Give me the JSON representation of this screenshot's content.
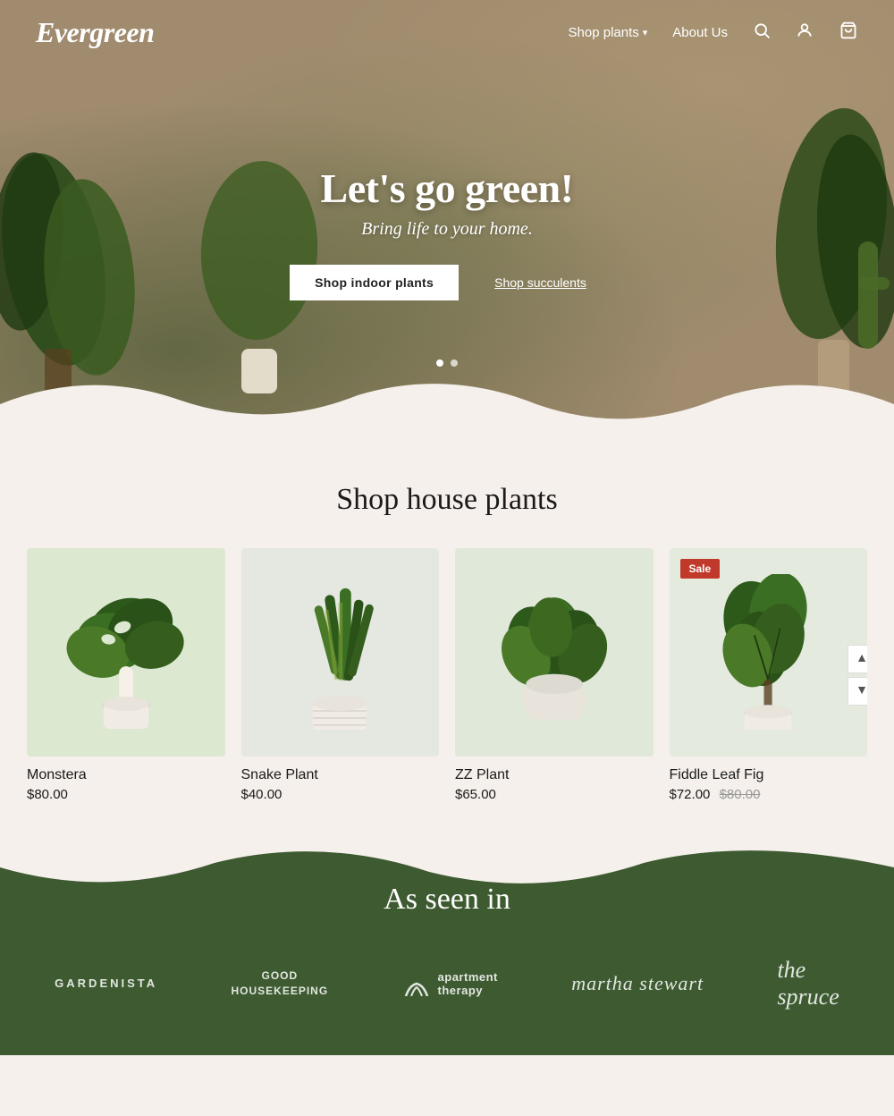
{
  "nav": {
    "logo": "Evergreen",
    "links": [
      {
        "id": "shop-plants",
        "label": "Shop plants",
        "hasDropdown": true
      },
      {
        "id": "about-us",
        "label": "About Us"
      }
    ],
    "icons": {
      "search": "🔍",
      "account": "👤",
      "cart": "🛒"
    }
  },
  "hero": {
    "title": "Let's go green!",
    "subtitle": "Bring life to your home.",
    "button_primary": "Shop indoor plants",
    "button_secondary": "Shop succulents",
    "dots": [
      {
        "active": true
      },
      {
        "active": false
      }
    ]
  },
  "shop": {
    "section_title": "Shop house plants",
    "products": [
      {
        "id": "monstera",
        "name": "Monstera",
        "price": "$80.00",
        "original_price": null,
        "sale": false,
        "color": "#d4e8c2"
      },
      {
        "id": "snake-plant",
        "name": "Snake Plant",
        "price": "$40.00",
        "original_price": null,
        "sale": false,
        "color": "#e0ead4"
      },
      {
        "id": "zz-plant",
        "name": "ZZ Plant",
        "price": "$65.00",
        "original_price": null,
        "sale": false,
        "color": "#dce8d8"
      },
      {
        "id": "fiddle-leaf-fig",
        "name": "Fiddle Leaf Fig",
        "price": "$72.00",
        "original_price": "$80.00",
        "sale": true,
        "sale_label": "Sale",
        "color": "#e4ead8"
      }
    ]
  },
  "as_seen_in": {
    "title": "As seen in",
    "brands": [
      {
        "id": "gardenista",
        "label": "GARDENISTA",
        "class": "gardenista"
      },
      {
        "id": "good-housekeeping",
        "label": "GOOD\nHOUSEKEEPING",
        "class": "good-housekeeping"
      },
      {
        "id": "apartment-therapy",
        "label": "apartment therapy",
        "class": "apartment-therapy"
      },
      {
        "id": "martha-stewart",
        "label": "martha stewart",
        "class": "martha-stewart"
      },
      {
        "id": "the-spruce",
        "label": "the spruce",
        "class": "the-spruce"
      }
    ]
  }
}
